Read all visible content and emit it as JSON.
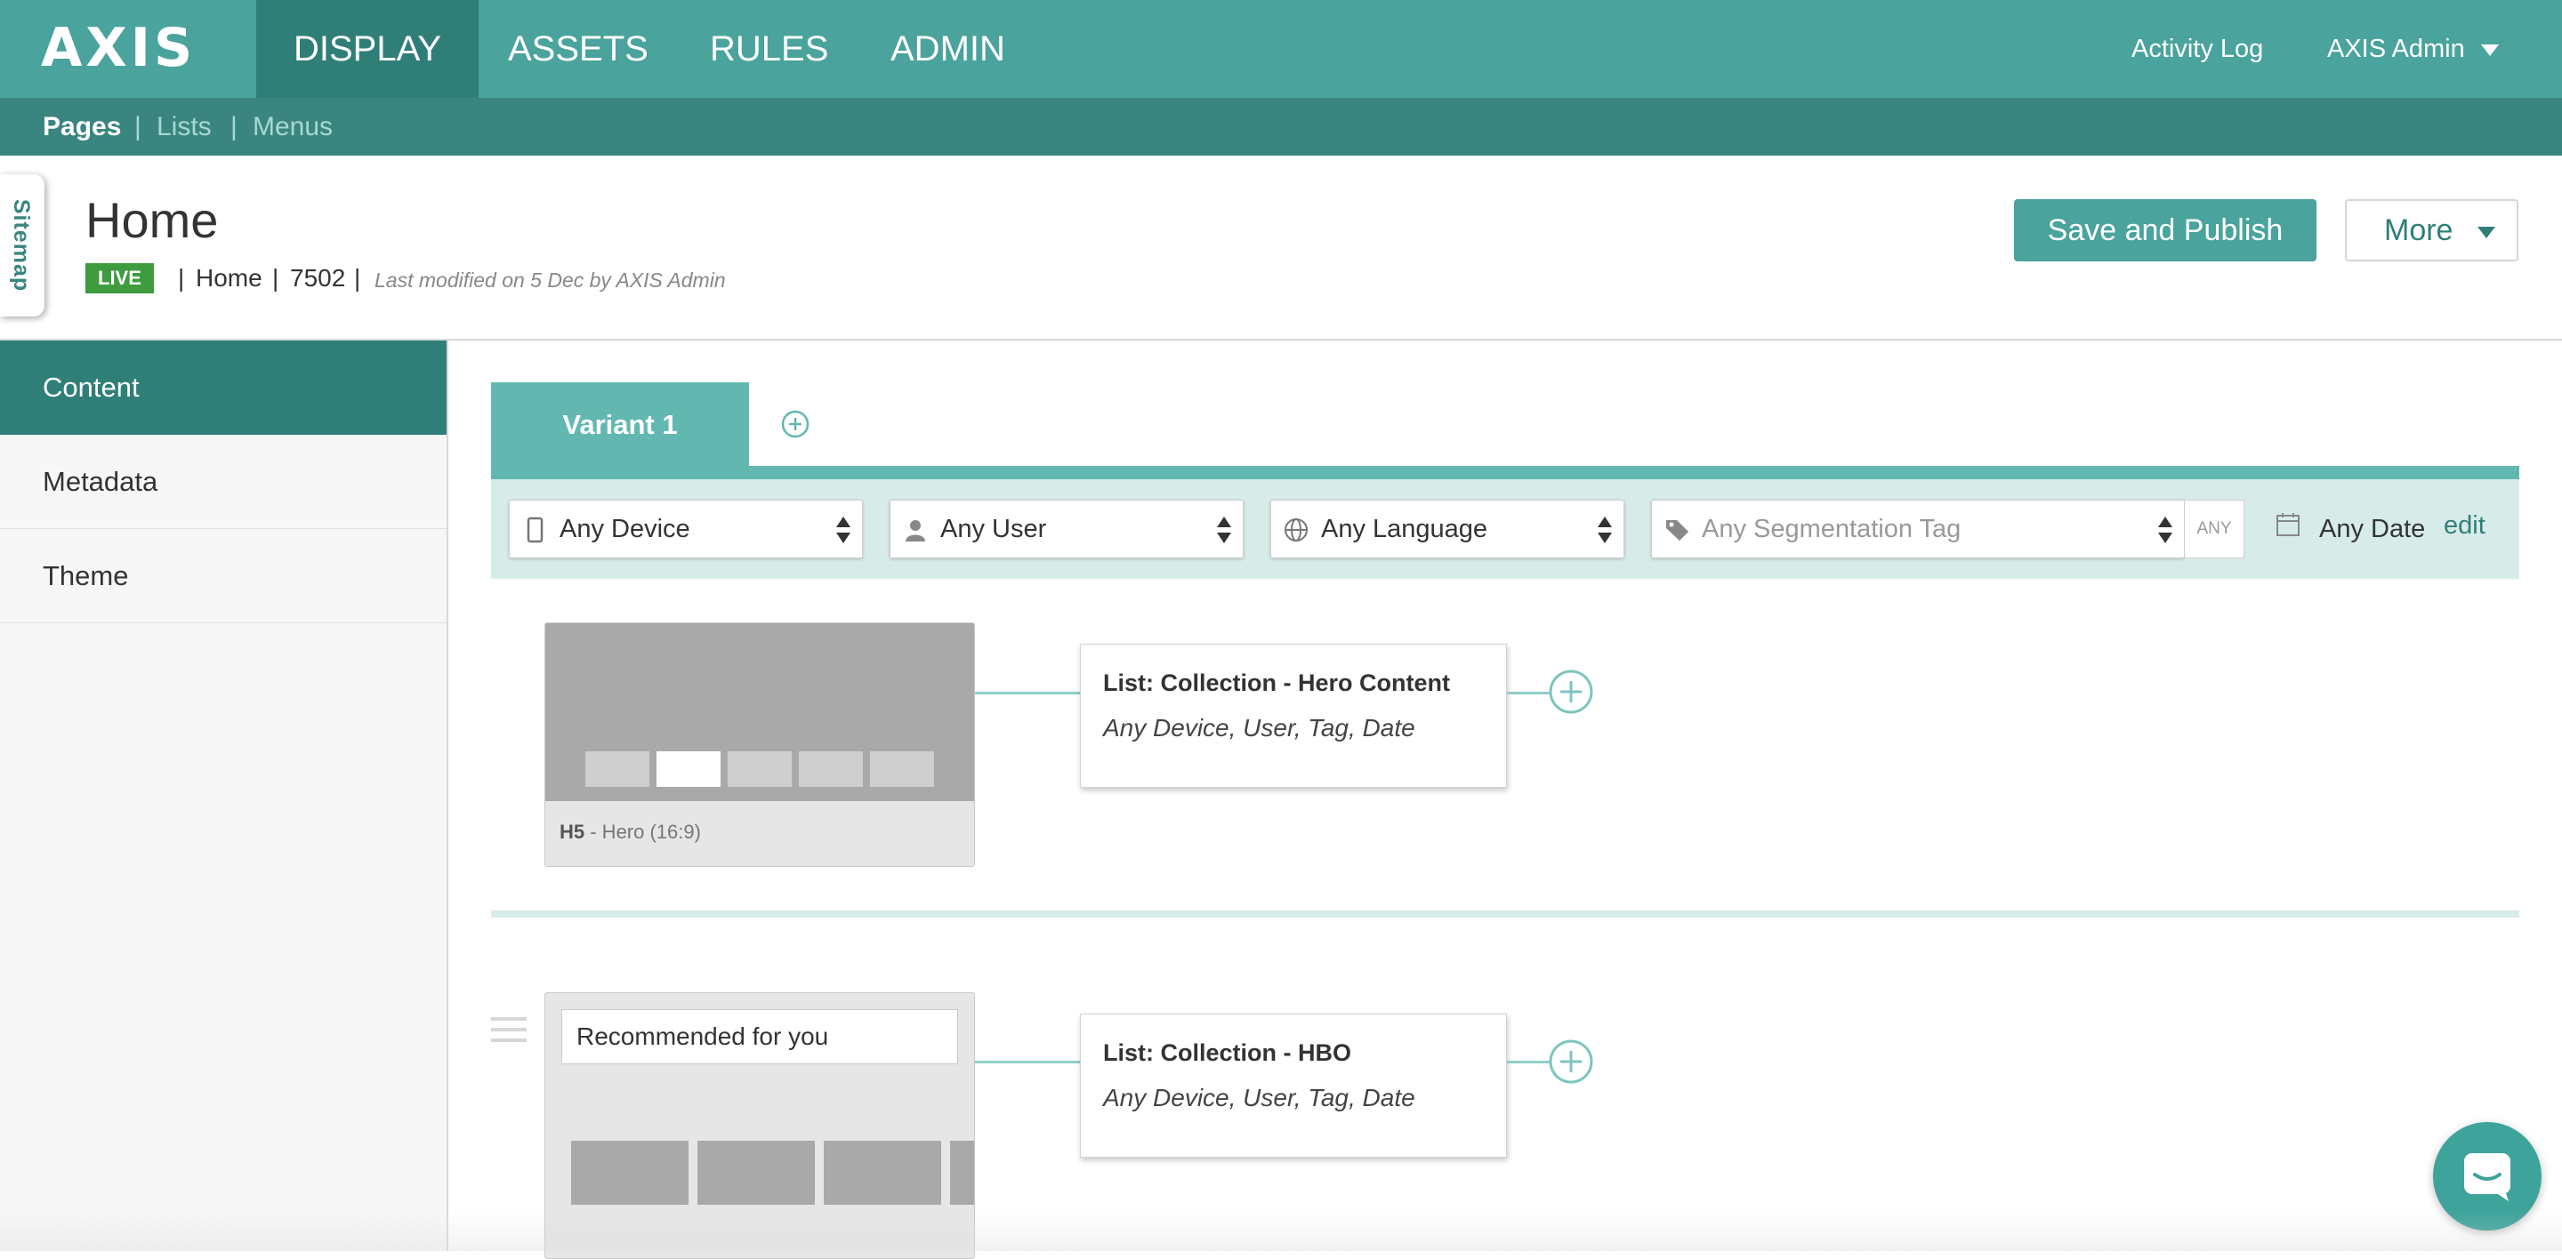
{
  "app": {
    "logo": "AXIS"
  },
  "topnav": {
    "items": [
      {
        "label": "DISPLAY",
        "active": true
      },
      {
        "label": "ASSETS",
        "active": false
      },
      {
        "label": "RULES",
        "active": false
      },
      {
        "label": "ADMIN",
        "active": false
      }
    ],
    "activity_log": "Activity Log",
    "user_menu": "AXIS Admin"
  },
  "subnav": {
    "items": [
      {
        "label": "Pages",
        "active": true
      },
      {
        "label": "Lists",
        "active": false
      },
      {
        "label": "Menus",
        "active": false
      }
    ],
    "separator": "|"
  },
  "sitemap_tab": "Sitemap",
  "page": {
    "title": "Home",
    "status": "LIVE",
    "path": "Home",
    "id": "7502",
    "separator": "|",
    "last_modified": "Last modified on 5 Dec by AXIS Admin"
  },
  "actions": {
    "save_publish": "Save and Publish",
    "more": "More"
  },
  "sidebar": {
    "items": [
      {
        "label": "Content",
        "active": true
      },
      {
        "label": "Metadata",
        "active": false
      },
      {
        "label": "Theme",
        "active": false
      }
    ]
  },
  "variants": {
    "tabs": [
      {
        "label": "Variant 1",
        "active": true
      }
    ]
  },
  "filters": {
    "device": {
      "value": "Any Device",
      "icon": "device-icon"
    },
    "user": {
      "value": "Any User",
      "icon": "user-icon"
    },
    "language": {
      "value": "Any Language",
      "icon": "globe-icon"
    },
    "segmentation": {
      "placeholder": "Any Segmentation Tag",
      "icon": "tag-icon",
      "any_label": "ANY"
    },
    "date": {
      "value": "Any Date",
      "icon": "calendar-icon",
      "edit": "edit"
    }
  },
  "rows": [
    {
      "template_code": "H5",
      "template_name": " - Hero (16:9)",
      "list_title": "List: Collection - Hero Content",
      "list_targeting": "Any Device, User, Tag, Date"
    },
    {
      "row_title": "Recommended for you",
      "list_title": "List: Collection - HBO",
      "list_targeting": "Any Device, User, Tag, Date"
    }
  ],
  "colors": {
    "primary": "#4aa39c",
    "primary_dark": "#2f7f78",
    "subnav": "#3a8580",
    "live_badge": "#3e9c3f",
    "filter_bg": "#d7ebe9"
  }
}
